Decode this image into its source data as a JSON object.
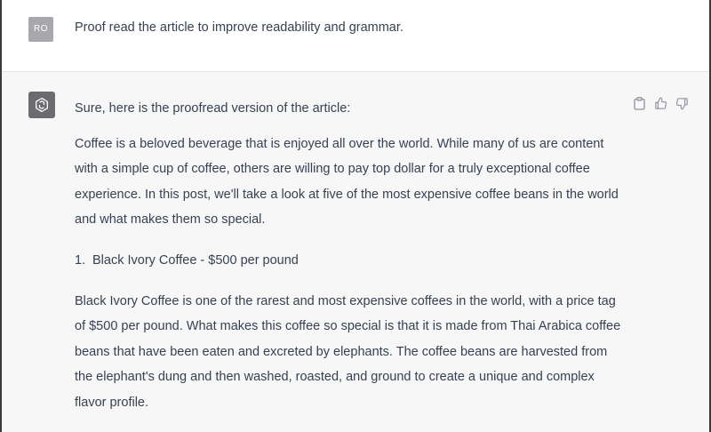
{
  "user_message": {
    "avatar_initials": "RO",
    "text": "Proof read the article to improve readability and grammar."
  },
  "assistant_message": {
    "avatar_icon": "openai-logo-icon",
    "intro": "Sure, here is the proofread version of the article:",
    "paragraph_1": "Coffee is a beloved beverage that is enjoyed all over the world. While many of us are content with a simple cup of coffee, others are willing to pay top dollar for a truly exceptional coffee experience. In this post, we'll take a look at five of the most expensive coffee beans in the world and what makes them so special.",
    "list_item_1": {
      "number": "1.",
      "text": "Black Ivory Coffee - $500 per pound"
    },
    "paragraph_2": "Black Ivory Coffee is one of the rarest and most expensive coffees in the world, with a price tag of $500 per pound. What makes this coffee so special is that it is made from Thai Arabica coffee beans that have been eaten and excreted by elephants. The coffee beans are harvested from the elephant's dung and then washed, roasted, and ground to create a unique and complex flavor profile."
  },
  "actions": {
    "copy_icon": "clipboard-icon",
    "like_icon": "thumbs-up-icon",
    "dislike_icon": "thumbs-down-icon"
  },
  "colors": {
    "user_avatar_bg": "#a7a7ac",
    "assistant_row_bg": "#f7f7f8",
    "assistant_avatar_bg": "#6b6b70",
    "text": "#374151"
  }
}
